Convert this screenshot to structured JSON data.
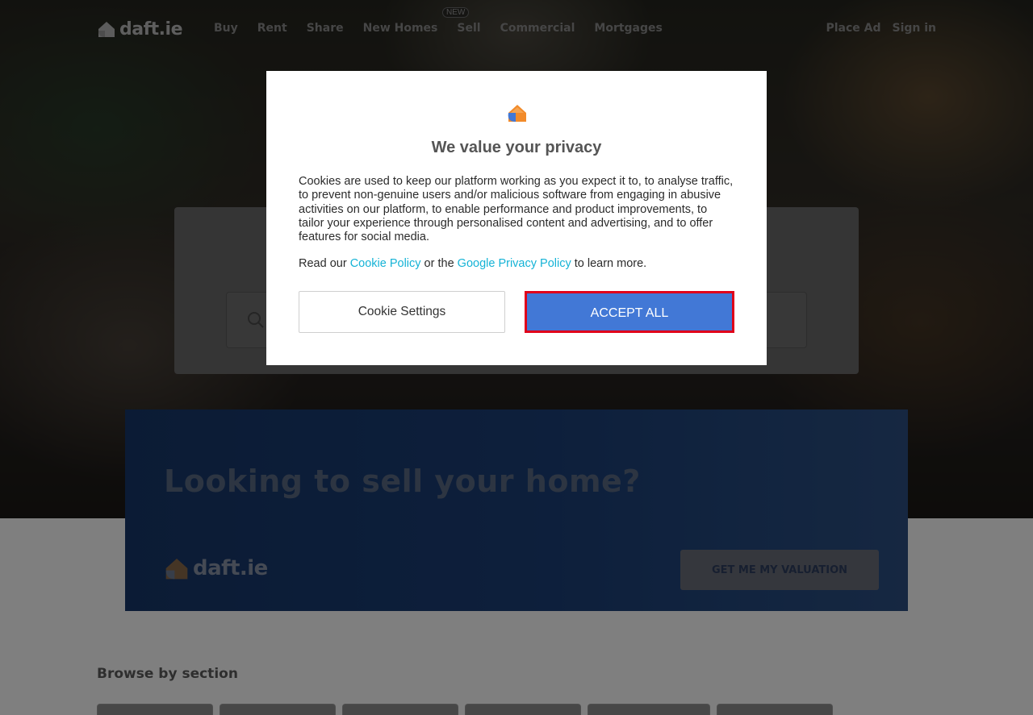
{
  "nav": {
    "logo_text": "daft.ie",
    "links": [
      "Buy",
      "Rent",
      "Share",
      "New Homes",
      "Sell",
      "Commercial",
      "Mortgages"
    ],
    "new_badge": "NEW",
    "place_ad": "Place Ad",
    "sign_in": "Sign in"
  },
  "banner": {
    "title": "Looking to sell your home?",
    "logo_text": "daft.ie",
    "cta": "GET ME MY VALUATION"
  },
  "browse": {
    "title": "Browse by section"
  },
  "modal": {
    "title": "We value your privacy",
    "body": "Cookies are used to keep our platform working as you expect it to, to analyse traffic, to prevent non-genuine users and/or malicious software from engaging in abusive activities on our platform, to enable performance and product improvements, to tailor your experience through personalised content and advertising, and to offer features for social media.",
    "read_prefix": "Read our ",
    "cookie_policy": "Cookie Policy",
    "or_the": " or the ",
    "google_policy": "Google Privacy Policy",
    "read_suffix": " to learn more.",
    "settings_button": "Cookie Settings",
    "accept_button": "ACCEPT ALL"
  },
  "colors": {
    "brand_orange": "#f28b2a",
    "brand_blue": "#4278d6",
    "link": "#15b3d6",
    "highlight": "#e0001a"
  }
}
